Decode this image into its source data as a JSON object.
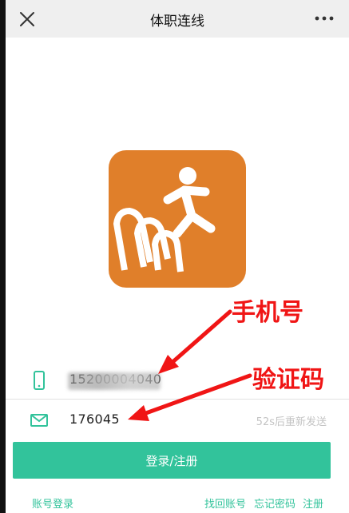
{
  "header": {
    "title": "体职连线",
    "close_icon": "close-icon",
    "more_icon": "more-icon"
  },
  "app": {
    "logo_icon": "runner-logo-icon",
    "logo_color": "#E07F2A"
  },
  "form": {
    "phone": {
      "icon": "phone-icon",
      "value": "15200004040"
    },
    "code": {
      "icon": "mail-icon",
      "value": "176045",
      "resend_label": "52s后重新发送"
    },
    "submit_label": "登录/注册"
  },
  "links": {
    "account_login": "账号登录",
    "find_account": "找回账号",
    "forgot_password": "忘记密码",
    "register": "注册"
  },
  "annotations": {
    "phone_label": "手机号",
    "code_label": "验证码"
  },
  "colors": {
    "accent": "#32C39B",
    "annotation": "#F01515",
    "header_bg": "#EFEFEF"
  }
}
